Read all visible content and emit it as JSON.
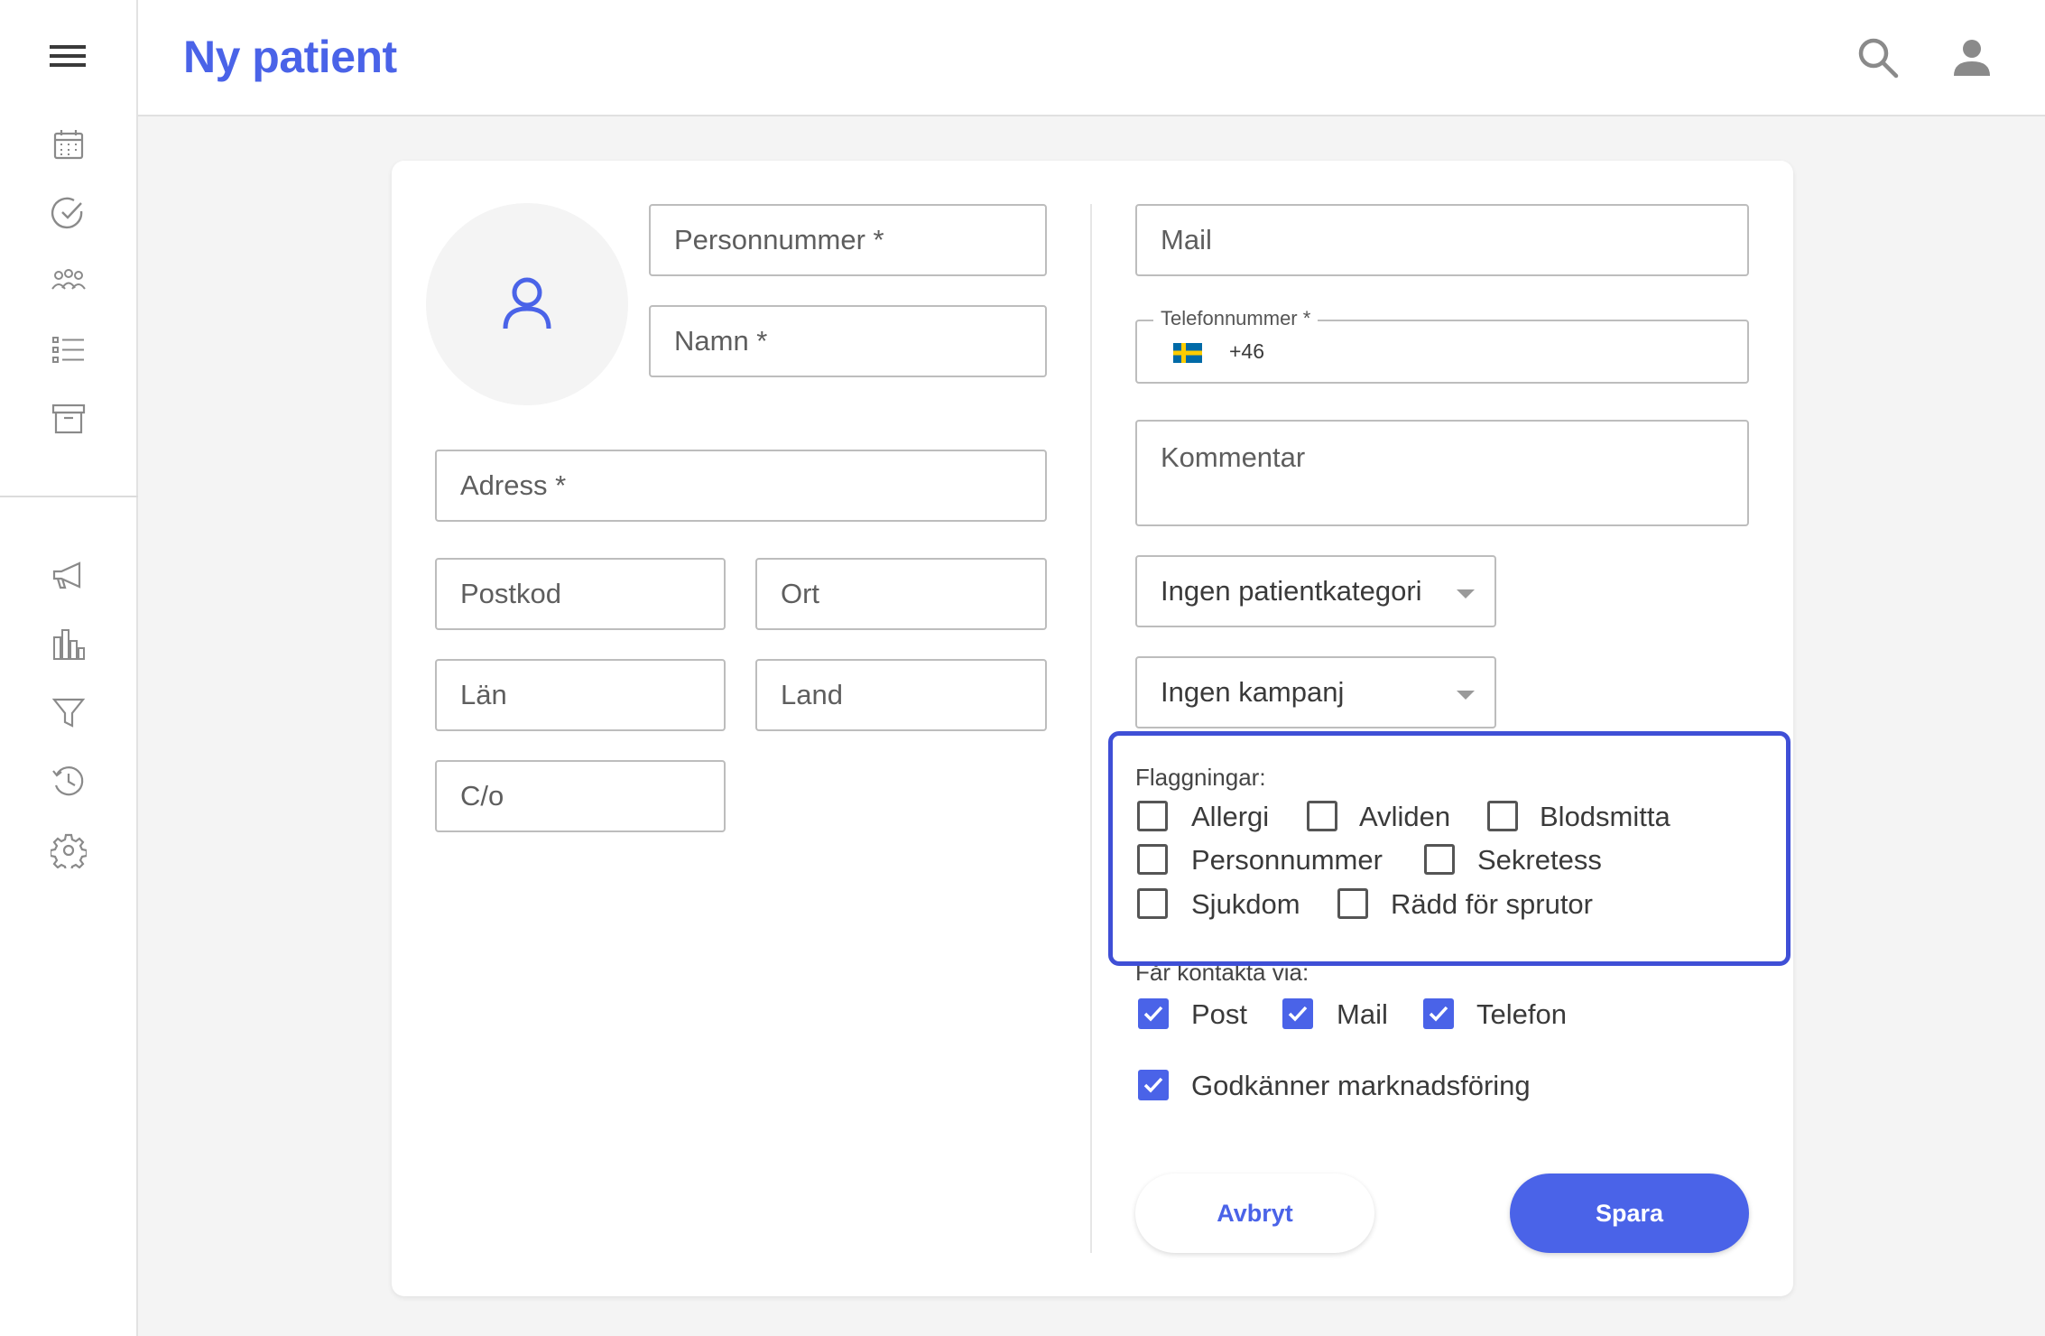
{
  "header": {
    "title": "Ny patient"
  },
  "form": {
    "personnummer": "Personnummer *",
    "namn": "Namn *",
    "adress": "Adress *",
    "postkod": "Postkod",
    "ort": "Ort",
    "lan": "Län",
    "land": "Land",
    "co": "C/o",
    "mail": "Mail",
    "telefon_label": "Telefonnummer *",
    "telefon_prefix": "+46",
    "kommentar": "Kommentar",
    "patientkategori": "Ingen patientkategori",
    "kampanj": "Ingen kampanj"
  },
  "flags": {
    "label": "Flaggningar:",
    "allergi": "Allergi",
    "avliden": "Avliden",
    "blodsmitta": "Blodsmitta",
    "personnummer": "Personnummer",
    "sekretess": "Sekretess",
    "sjukdom": "Sjukdom",
    "radd": "Rädd för sprutor"
  },
  "contact": {
    "label": "Får kontakta via:",
    "post": "Post",
    "mail": "Mail",
    "telefon": "Telefon",
    "marketing": "Godkänner marknadsföring"
  },
  "actions": {
    "cancel": "Avbryt",
    "save": "Spara"
  },
  "colors": {
    "accent": "#4a63e8",
    "highlight": "#3f4fd6"
  }
}
